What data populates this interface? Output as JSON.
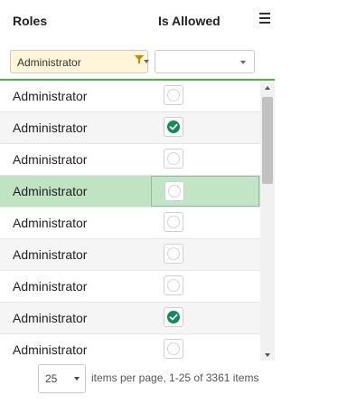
{
  "header": {
    "roles_label": "Roles",
    "allowed_label": "Is Allowed",
    "menu_icon": "hamburger-menu-icon"
  },
  "filters": {
    "roles_value": "Administrator",
    "roles_icon": "filter-funnel-icon",
    "allowed_value": ""
  },
  "rows": [
    {
      "role": "Administrator",
      "allowed": false
    },
    {
      "role": "Administrator",
      "allowed": true
    },
    {
      "role": "Administrator",
      "allowed": false
    },
    {
      "role": "Administrator",
      "allowed": false,
      "selected": true
    },
    {
      "role": "Administrator",
      "allowed": false
    },
    {
      "role": "Administrator",
      "allowed": false
    },
    {
      "role": "Administrator",
      "allowed": false
    },
    {
      "role": "Administrator",
      "allowed": true
    },
    {
      "role": "Administrator",
      "allowed": false
    }
  ],
  "pager": {
    "page_size": "25",
    "summary": "items per page,  1-25 of 3361 items"
  },
  "colors": {
    "accent_green": "#4caf50",
    "selected_row": "#bfe3c3",
    "check_on": "#138a5a",
    "filter_active": "#fff6d9"
  }
}
